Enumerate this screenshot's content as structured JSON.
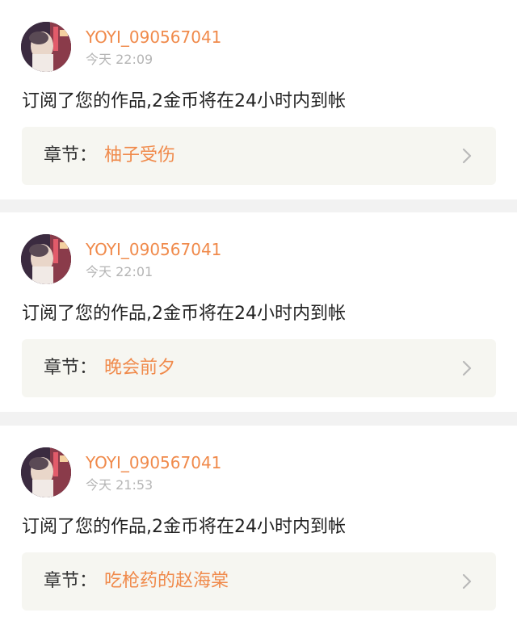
{
  "notifications": [
    {
      "username": "YOYI_090567041",
      "time": "今天 22:09",
      "message": "订阅了您的作品,2金币将在24小时内到帐",
      "chapter_prefix": "章节：",
      "chapter_title": "柚子受伤"
    },
    {
      "username": "YOYI_090567041",
      "time": "今天 22:01",
      "message": "订阅了您的作品,2金币将在24小时内到帐",
      "chapter_prefix": "章节：",
      "chapter_title": "晚会前夕"
    },
    {
      "username": "YOYI_090567041",
      "time": "今天 21:53",
      "message": "订阅了您的作品,2金币将在24小时内到帐",
      "chapter_prefix": "章节：",
      "chapter_title": "吃枪药的赵海棠"
    }
  ],
  "icons": {
    "chevron": "chevron-right-icon",
    "avatar": "avatar"
  },
  "colors": {
    "accent": "#f08a4b",
    "time_gray": "#b5b5b5",
    "chapter_bg": "#f6f6f1",
    "separator": "#f2f2f2"
  }
}
